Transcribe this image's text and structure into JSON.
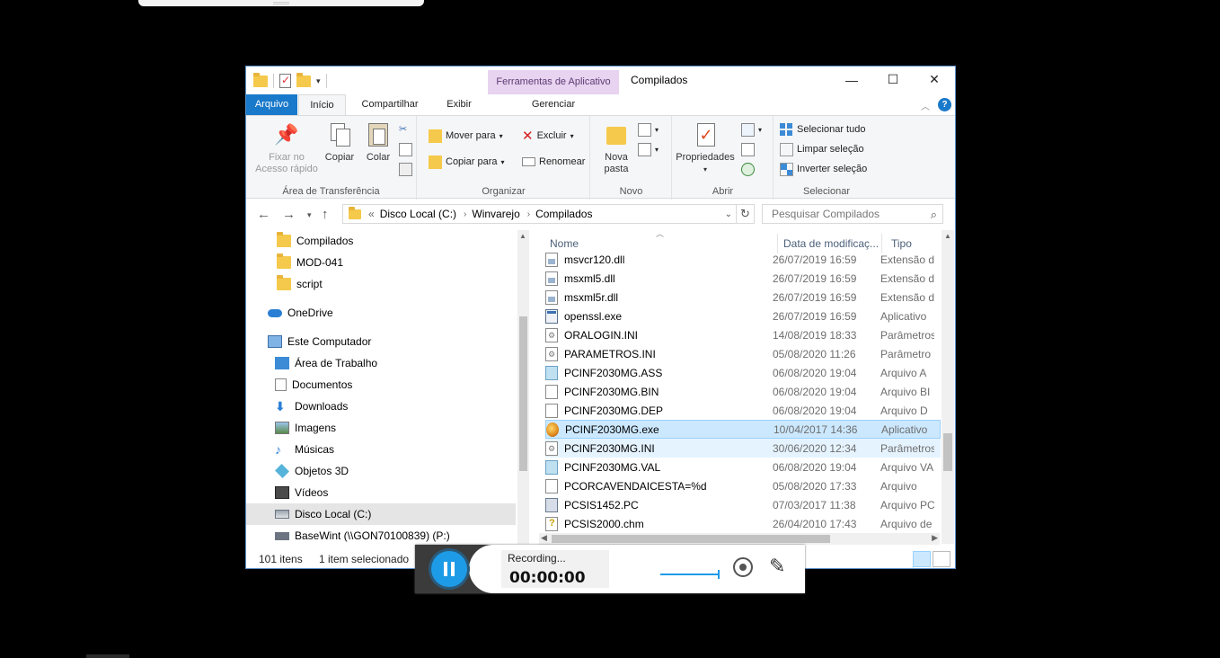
{
  "window": {
    "title": "Compilados",
    "context_tool_group": "Ferramentas de Aplicativo",
    "controls": {
      "minimize": "—",
      "maximize": "☐",
      "close": "✕"
    }
  },
  "tabs": {
    "file": "Arquivo",
    "home": "Início",
    "share": "Compartilhar",
    "view": "Exibir",
    "manage": "Gerenciar"
  },
  "ribbon": {
    "clipboard": {
      "label": "Área de Transferência",
      "pin_line1": "Fixar no",
      "pin_line2": "Acesso rápido",
      "copy": "Copiar",
      "paste": "Colar"
    },
    "organize": {
      "label": "Organizar",
      "move_to": "Mover para",
      "copy_to": "Copiar para",
      "delete": "Excluir",
      "rename": "Renomear"
    },
    "new": {
      "label": "Novo",
      "new_folder_line1": "Nova",
      "new_folder_line2": "pasta"
    },
    "open": {
      "label": "Abrir",
      "properties": "Propriedades"
    },
    "select": {
      "label": "Selecionar",
      "select_all": "Selecionar tudo",
      "select_none": "Limpar seleção",
      "invert": "Inverter seleção"
    }
  },
  "address": {
    "prefix": "«",
    "crumbs": [
      "Disco Local (C:)",
      "Winvarejo",
      "Compilados"
    ],
    "search_placeholder": "Pesquisar Compilados"
  },
  "nav": [
    {
      "label": "Compilados",
      "icon": "folder-icon"
    },
    {
      "label": "MOD-041",
      "icon": "folder-icon"
    },
    {
      "label": "script",
      "icon": "folder-icon"
    },
    {
      "label": "OneDrive",
      "icon": "cloud-icon"
    },
    {
      "label": "Este Computador",
      "icon": "computer-icon"
    },
    {
      "label": "Área de Trabalho",
      "icon": "desktop-icon"
    },
    {
      "label": "Documentos",
      "icon": "documents-icon"
    },
    {
      "label": "Downloads",
      "icon": "download-icon"
    },
    {
      "label": "Imagens",
      "icon": "pictures-icon"
    },
    {
      "label": "Músicas",
      "icon": "music-icon"
    },
    {
      "label": "Objetos 3D",
      "icon": "cube-icon"
    },
    {
      "label": "Vídeos",
      "icon": "video-icon"
    },
    {
      "label": "Disco Local (C:)",
      "icon": "drive-icon"
    },
    {
      "label": "BaseWint (\\\\GON70100839) (P:)",
      "icon": "network-drive-icon"
    }
  ],
  "columns": {
    "name": "Nome",
    "date": "Data de modificaç...",
    "type": "Tipo"
  },
  "files": [
    {
      "name": "msvcr120.dll",
      "date": "26/07/2019 16:59",
      "type": "Extensão d",
      "icon": "dll"
    },
    {
      "name": "msxml5.dll",
      "date": "26/07/2019 16:59",
      "type": "Extensão d",
      "icon": "dll"
    },
    {
      "name": "msxml5r.dll",
      "date": "26/07/2019 16:59",
      "type": "Extensão d",
      "icon": "dll"
    },
    {
      "name": "openssl.exe",
      "date": "26/07/2019 16:59",
      "type": "Aplicativo",
      "icon": "exe"
    },
    {
      "name": "ORALOGIN.INI",
      "date": "14/08/2019 18:33",
      "type": "Parâmetros",
      "icon": "ini"
    },
    {
      "name": "PARAMETROS.INI",
      "date": "05/08/2020 11:26",
      "type": "Parâmetro",
      "icon": "ini"
    },
    {
      "name": "PCINF2030MG.ASS",
      "date": "06/08/2020 19:04",
      "type": "Arquivo A",
      "icon": "ass"
    },
    {
      "name": "PCINF2030MG.BIN",
      "date": "06/08/2020 19:04",
      "type": "Arquivo BI",
      "icon": "doc"
    },
    {
      "name": "PCINF2030MG.DEP",
      "date": "06/08/2020 19:04",
      "type": "Arquivo D",
      "icon": "doc"
    },
    {
      "name": "PCINF2030MG.exe",
      "date": "10/04/2017 14:36",
      "type": "Aplicativo",
      "icon": "app"
    },
    {
      "name": "PCINF2030MG.INI",
      "date": "30/06/2020 12:34",
      "type": "Parâmetros",
      "icon": "ini"
    },
    {
      "name": "PCINF2030MG.VAL",
      "date": "06/08/2020 19:04",
      "type": "Arquivo VA",
      "icon": "ass"
    },
    {
      "name": "PCORCAVENDAICESTA=%d",
      "date": "05/08/2020 17:33",
      "type": "Arquivo",
      "icon": "doc"
    },
    {
      "name": "PCSIS1452.PC",
      "date": "07/03/2017 11:38",
      "type": "Arquivo PC",
      "icon": "pc"
    },
    {
      "name": "PCSIS2000.chm",
      "date": "26/04/2010 17:43",
      "type": "Arquivo de",
      "icon": "chm"
    }
  ],
  "status": {
    "count": "101 itens",
    "selected": "1 item selecionado"
  },
  "recorder": {
    "state": "Recording...",
    "time": "00:00:00"
  }
}
